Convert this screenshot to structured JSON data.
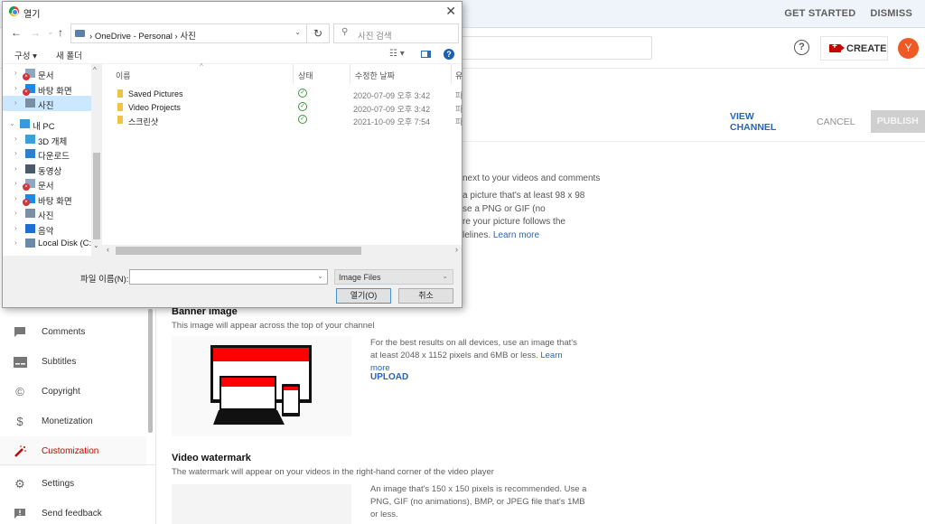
{
  "youtube": {
    "banner_actions": [
      "GET STARTED",
      "DISMISS"
    ],
    "header": {
      "search_placeholder": "",
      "help_label": "?",
      "create_label": "CREATE",
      "avatar_letter": "Y",
      "avatar_color": "#ef5a24"
    },
    "page_actions": {
      "view_channel": "VIEW CHANNEL",
      "cancel": "CANCEL",
      "publish": "PUBLISH"
    },
    "profile_picture_partial": {
      "line1": "next to your videos and comments",
      "line2": "a picture that's at least 98 x 98",
      "line3": "se a PNG or GIF (no",
      "line4": "re your picture follows the",
      "line5": "lelines.",
      "learn_more": "Learn more"
    },
    "sidebar": {
      "items": [
        {
          "label": "Comments",
          "icon": "comment-icon",
          "active": false
        },
        {
          "label": "Subtitles",
          "icon": "subtitles-icon",
          "active": false
        },
        {
          "label": "Copyright",
          "icon": "copyright-icon",
          "active": false
        },
        {
          "label": "Monetization",
          "icon": "dollar-icon",
          "active": false
        },
        {
          "label": "Customization",
          "icon": "magic-wand-icon",
          "active": true
        },
        {
          "label": "Settings",
          "icon": "gear-icon",
          "active": false
        },
        {
          "label": "Send feedback",
          "icon": "feedback-icon",
          "active": false
        }
      ]
    },
    "banner_image": {
      "title": "Banner image",
      "subtitle": "This image will appear across the top of your channel",
      "description": "For the best results on all devices, use an image that's at least 2048 x 1152 pixels and 6MB or less.",
      "learn_more": "Learn more",
      "upload": "UPLOAD"
    },
    "video_watermark": {
      "title": "Video watermark",
      "subtitle": "The watermark will appear on your videos in the right-hand corner of the video player",
      "description": "An image that's 150 x 150 pixels is recommended. Use a PNG, GIF (no animations), BMP, or JPEG file that's 1MB or less."
    }
  },
  "dialog": {
    "title": "열기",
    "close": "✕",
    "nav": {
      "back": "←",
      "forward": "→",
      "recent": "⌄",
      "up": "↑",
      "refresh": "↻"
    },
    "address": {
      "path": [
        "OneDrive - Personal",
        "사진"
      ]
    },
    "search_placeholder": "사진 검색",
    "toolbar": {
      "organize": "구성 ▾",
      "new_folder": "새 폴더",
      "help": "?"
    },
    "tree": [
      {
        "label": "문서",
        "indent": 1,
        "error": true,
        "selected": false,
        "expanded": false
      },
      {
        "label": "바탕 화면",
        "indent": 1,
        "error": true,
        "selected": false,
        "expanded": false
      },
      {
        "label": "사진",
        "indent": 1,
        "error": false,
        "selected": true,
        "expanded": false
      },
      {
        "label": "내 PC",
        "indent": 0,
        "error": false,
        "selected": false,
        "expanded": true
      },
      {
        "label": "3D 개체",
        "indent": 1,
        "error": false,
        "selected": false,
        "expanded": false
      },
      {
        "label": "다운로드",
        "indent": 1,
        "error": false,
        "selected": false,
        "expanded": false
      },
      {
        "label": "동영상",
        "indent": 1,
        "error": false,
        "selected": false,
        "expanded": false
      },
      {
        "label": "문서",
        "indent": 1,
        "error": true,
        "selected": false,
        "expanded": false
      },
      {
        "label": "바탕 화면",
        "indent": 1,
        "error": true,
        "selected": false,
        "expanded": false
      },
      {
        "label": "사진",
        "indent": 1,
        "error": false,
        "selected": false,
        "expanded": false
      },
      {
        "label": "음악",
        "indent": 1,
        "error": false,
        "selected": false,
        "expanded": false
      },
      {
        "label": "Local Disk (C:)",
        "indent": 1,
        "error": false,
        "selected": false,
        "expanded": false
      }
    ],
    "columns": {
      "name": "이름",
      "status": "상태",
      "modified": "수정한 날짜",
      "type": "유"
    },
    "files": [
      {
        "name": "Saved Pictures",
        "status": "synced",
        "modified": "2020-07-09 오후 3:42",
        "type": "파"
      },
      {
        "name": "Video Projects",
        "status": "synced",
        "modified": "2020-07-09 오후 3:42",
        "type": "파"
      },
      {
        "name": "스크린샷",
        "status": "synced",
        "modified": "2021-10-09 오후 7:54",
        "type": "파"
      }
    ],
    "filename_label": "파일 이름(N):",
    "filename_value": "",
    "filetype": "Image Files",
    "open_button": "열기(O)",
    "cancel_button": "취소"
  }
}
